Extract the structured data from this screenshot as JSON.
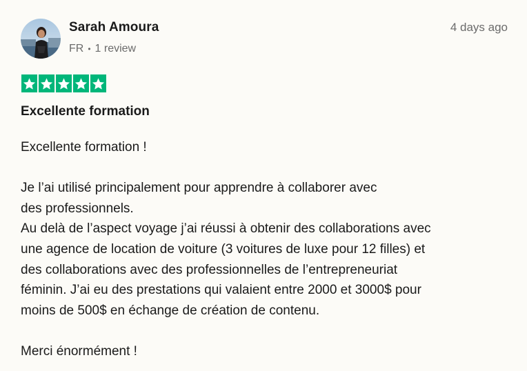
{
  "review": {
    "author_name": "Sarah Amoura",
    "country": "FR",
    "review_count": "1 review",
    "date": "4 days ago",
    "rating": 5,
    "rating_max": 5,
    "title": "Excellente formation",
    "body_lines": [
      "Excellente formation !",
      "",
      "Je l’ai utilisé principalement pour apprendre à collaborer avec",
      "des professionnels.",
      "Au delà de l’aspect voyage j’ai réussi à obtenir des collaborations avec",
      "une agence de location de voiture (3 voitures de luxe pour 12 filles) et",
      "des collaborations avec des professionnelles de l’entrepreneuriat",
      "féminin. J’ai eu des prestations qui valaient entre 2000 et 3000$ pour",
      "moins de 500$ en échange de création de contenu.",
      "",
      "Merci énormément !"
    ]
  },
  "colors": {
    "star_green": "#00b67a",
    "background": "#fcfbf7",
    "muted_text": "#6b6b6b"
  },
  "icons": {
    "star": "star-icon",
    "avatar": "profile-photo"
  }
}
